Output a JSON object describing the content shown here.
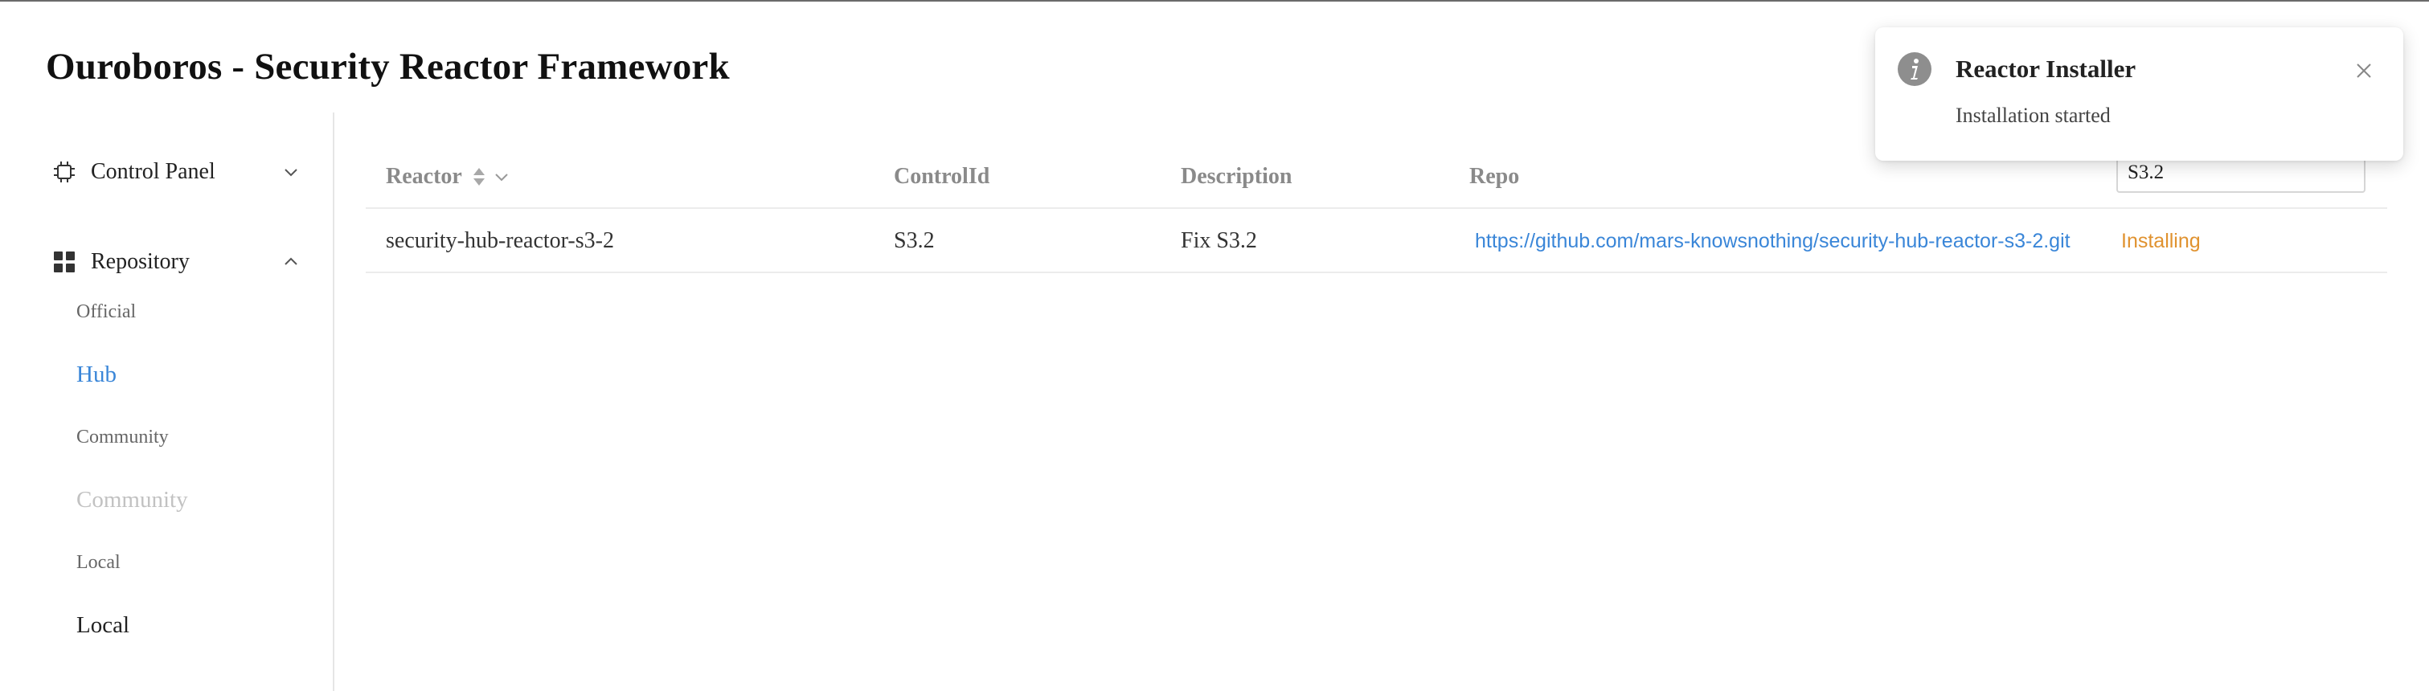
{
  "app": {
    "title": "Ouroboros - Security Reactor Framework"
  },
  "sidebar": {
    "menus": [
      {
        "label": "Control Panel",
        "icon": "cpu-chip-icon",
        "expanded": false
      },
      {
        "label": "Repository",
        "icon": "grid-apps-icon",
        "expanded": true,
        "items": [
          {
            "label": "Official",
            "state": "normal"
          },
          {
            "label": "Hub",
            "state": "selected"
          },
          {
            "label": "Community",
            "state": "normal"
          },
          {
            "label": "Community",
            "state": "disabled"
          },
          {
            "label": "Local",
            "state": "normal"
          },
          {
            "label": "Local",
            "state": "normal"
          }
        ]
      }
    ]
  },
  "table": {
    "columns": [
      "Reactor",
      "ControlId",
      "Description",
      "Repo"
    ],
    "search": {
      "value": "S3.2"
    },
    "rows": [
      {
        "reactor": "security-hub-reactor-s3-2",
        "control_id": "S3.2",
        "description": "Fix S3.2",
        "repo": "https://github.com/mars-knowsnothing/security-hub-reactor-s3-2.git",
        "status": "Installing"
      }
    ]
  },
  "notification": {
    "title": "Reactor Installer",
    "message": "Installation started",
    "icon": "info-circle-icon"
  },
  "colors": {
    "link": "#3a86d8",
    "status_installing": "#e0922f",
    "muted_header": "#8a8a8a",
    "disabled_text": "#c2c2c2"
  }
}
